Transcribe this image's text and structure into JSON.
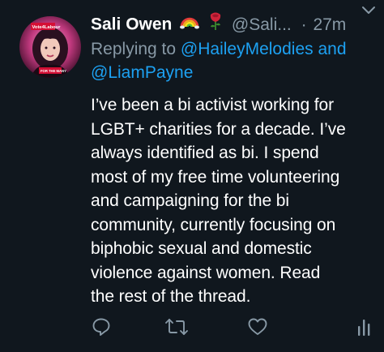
{
  "tweet": {
    "display_name": "Sali Owen",
    "handle": "@Sali...",
    "separator": "·",
    "time": "27m",
    "reply_prefix": "Replying to ",
    "reply_mention_1": "@HaileyMelodies",
    "reply_and": " and",
    "reply_mention_2": "@LiamPayne",
    "text_lines": [
      "I’ve been a bi activist working for",
      "LGBT+ charities for a decade. I’ve",
      "always identified as bi. I spend",
      "most of my free time volunteering",
      "and campaigning for the bi",
      "community, currently focusing on",
      "biphobic sexual and domestic",
      "violence against women. Read",
      "the rest of the thread."
    ],
    "avatar_overlay_text": "Vote4Labour",
    "avatar_caption": "FOR THE MANY"
  },
  "icons": {
    "rainbow": "rainbow-emoji",
    "rose": "rose-emoji",
    "menu": "chevron-down-icon",
    "reply": "reply-icon",
    "retweet": "retweet-icon",
    "like": "heart-icon",
    "analytics": "analytics-icon"
  },
  "colors": {
    "background": "#10171e",
    "text": "#ffffff",
    "secondary": "#8899a6",
    "link": "#1da1f2"
  }
}
